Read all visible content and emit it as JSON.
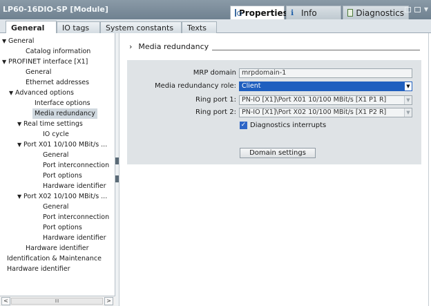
{
  "window": {
    "title": "LP60-16DIO-SP [Module]",
    "tabs": [
      {
        "label": "Properties",
        "icon": "properties-icon",
        "active": true
      },
      {
        "label": "Info",
        "icon": "info-icon",
        "active": false
      },
      {
        "label": "Diagnostics",
        "icon": "diagnostics-icon",
        "active": false
      }
    ]
  },
  "subtabs": [
    {
      "label": "General",
      "active": true
    },
    {
      "label": "IO tags",
      "active": false
    },
    {
      "label": "System constants",
      "active": false
    },
    {
      "label": "Texts",
      "active": false
    }
  ],
  "nav": {
    "items": [
      {
        "label": "General",
        "expanded": true
      },
      {
        "label": "Catalog information"
      },
      {
        "label": "PROFINET interface [X1]",
        "expanded": true
      },
      {
        "label": "General"
      },
      {
        "label": "Ethernet addresses"
      },
      {
        "label": "Advanced options",
        "expanded": true
      },
      {
        "label": "Interface options"
      },
      {
        "label": "Media redundancy",
        "selected": true
      },
      {
        "label": "Real time settings",
        "expanded": true
      },
      {
        "label": "IO cycle"
      },
      {
        "label": "Port X01 10/100 MBit/s ...",
        "expanded": true
      },
      {
        "label": "General"
      },
      {
        "label": "Port interconnection"
      },
      {
        "label": "Port options"
      },
      {
        "label": "Hardware identifier"
      },
      {
        "label": "Port X02 10/100 MBit/s ...",
        "expanded": true
      },
      {
        "label": "General"
      },
      {
        "label": "Port interconnection"
      },
      {
        "label": "Port options"
      },
      {
        "label": "Hardware identifier"
      },
      {
        "label": "Hardware identifier"
      },
      {
        "label": "Identification & Maintenance"
      },
      {
        "label": "Hardware identifier"
      }
    ],
    "scroll_left": "<",
    "scroll_thumb": "III",
    "scroll_right": ">"
  },
  "main": {
    "section_title": "Media redundancy",
    "section_chevron": "›",
    "fields": {
      "mrp_domain_label": "MRP domain",
      "mrp_domain_value": "mrpdomain-1",
      "role_label": "Media redundancy role:",
      "role_value": "Client",
      "ring1_label": "Ring port 1:",
      "ring1_value": "PN-IO [X1]\\Port X01 10/100 MBit/s [X1 P1 R]",
      "ring2_label": "Ring port 2:",
      "ring2_value": "PN-IO [X1]\\Port X02 10/100 MBit/s [X1 P2 R]",
      "diag_label": "Diagnostics interrupts",
      "diag_checked": true
    },
    "domain_button": "Domain settings"
  },
  "colors": {
    "titlebar": "#7a8b98",
    "selection": "#1f5fbf",
    "panel": "#dfe3e6"
  }
}
